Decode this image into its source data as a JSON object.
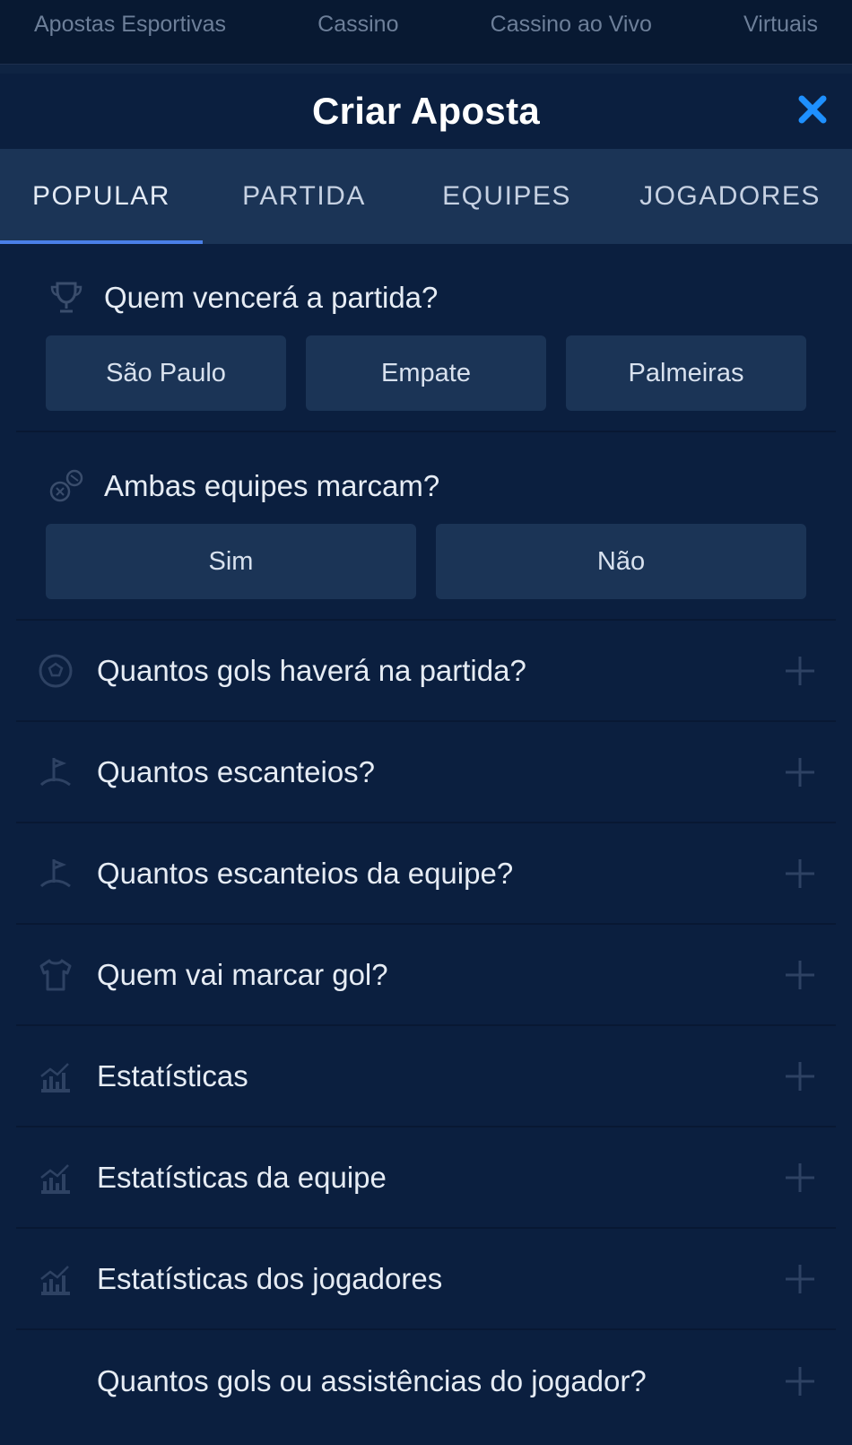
{
  "topnav": {
    "items": [
      "Apostas Esportivas",
      "Cassino",
      "Cassino ao Vivo",
      "Virtuais"
    ]
  },
  "modal": {
    "title": "Criar Aposta",
    "close_icon": "close-icon",
    "accent_color": "#1e90ff"
  },
  "tabs": [
    {
      "label": "POPULAR",
      "active": true
    },
    {
      "label": "PARTIDA",
      "active": false
    },
    {
      "label": "EQUIPES",
      "active": false
    },
    {
      "label": "JOGADORES",
      "active": false
    }
  ],
  "sections": [
    {
      "question": "Quem vencerá a partida?",
      "icon": "trophy-icon",
      "options": [
        "São Paulo",
        "Empate",
        "Palmeiras"
      ]
    },
    {
      "question": "Ambas equipes marcam?",
      "icon": "balls-icon",
      "options": [
        "Sim",
        "Não"
      ]
    }
  ],
  "collapsed_rows": [
    {
      "label": "Quantos gols haverá na partida?",
      "icon": "soccer-ball-icon"
    },
    {
      "label": "Quantos escanteios?",
      "icon": "corner-flag-icon"
    },
    {
      "label": "Quantos escanteios da equipe?",
      "icon": "corner-flag-icon"
    },
    {
      "label": "Quem vai marcar gol?",
      "icon": "jersey-icon"
    },
    {
      "label": "Estatísticas",
      "icon": "stats-chart-icon"
    },
    {
      "label": "Estatísticas da equipe",
      "icon": "stats-chart-icon"
    },
    {
      "label": "Estatísticas dos jogadores",
      "icon": "stats-chart-icon"
    },
    {
      "label": "Quantos gols ou assistências do jogador?",
      "icon": ""
    }
  ]
}
